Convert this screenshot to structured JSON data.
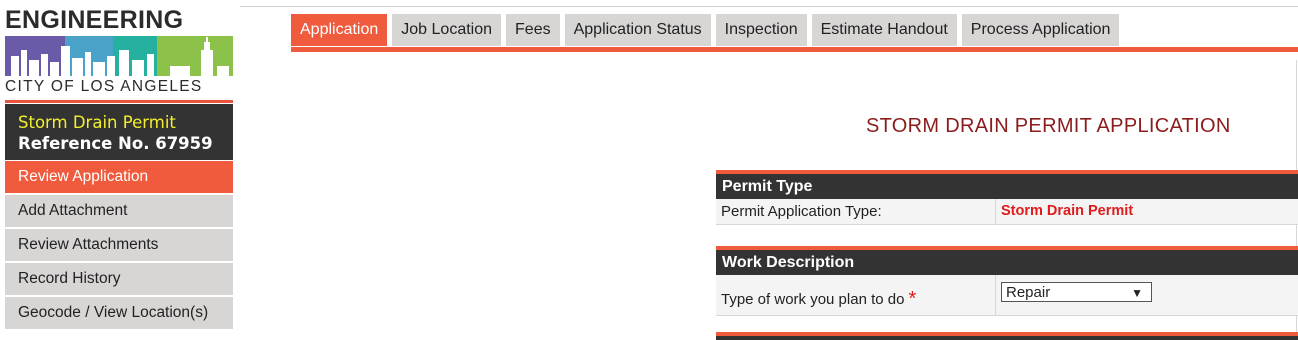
{
  "logo": {
    "wordmark": "ENGINEERING",
    "city": "CITY OF LOS ANGELES"
  },
  "permit_card": {
    "title": "Storm Drain Permit",
    "reference": "Reference No. 67959"
  },
  "sidebar": {
    "items": [
      {
        "label": "Review Application",
        "active": true
      },
      {
        "label": "Add Attachment"
      },
      {
        "label": "Review Attachments"
      },
      {
        "label": "Record History"
      },
      {
        "label": "Geocode / View Location(s)"
      }
    ]
  },
  "tabs": [
    {
      "label": "Application",
      "active": true
    },
    {
      "label": "Job Location"
    },
    {
      "label": "Fees"
    },
    {
      "label": "Application Status"
    },
    {
      "label": "Inspection"
    },
    {
      "label": "Estimate Handout"
    },
    {
      "label": "Process Application"
    }
  ],
  "main": {
    "page_title": "STORM DRAIN PERMIT APPLICATION",
    "permit_type": {
      "header": "Permit Type",
      "label": "Permit Application Type:",
      "value": "Storm Drain Permit"
    },
    "work_description": {
      "header": "Work Description",
      "label": "Type of work you plan to do",
      "required_mark": "*",
      "selected": "Repair",
      "caret": "▼"
    }
  },
  "colors": {
    "accent": "#f05a3d",
    "dark_header": "#333333",
    "title_red": "#8b1c1c",
    "value_red": "#e01b1b",
    "card_yellow": "#f2ef2e"
  }
}
